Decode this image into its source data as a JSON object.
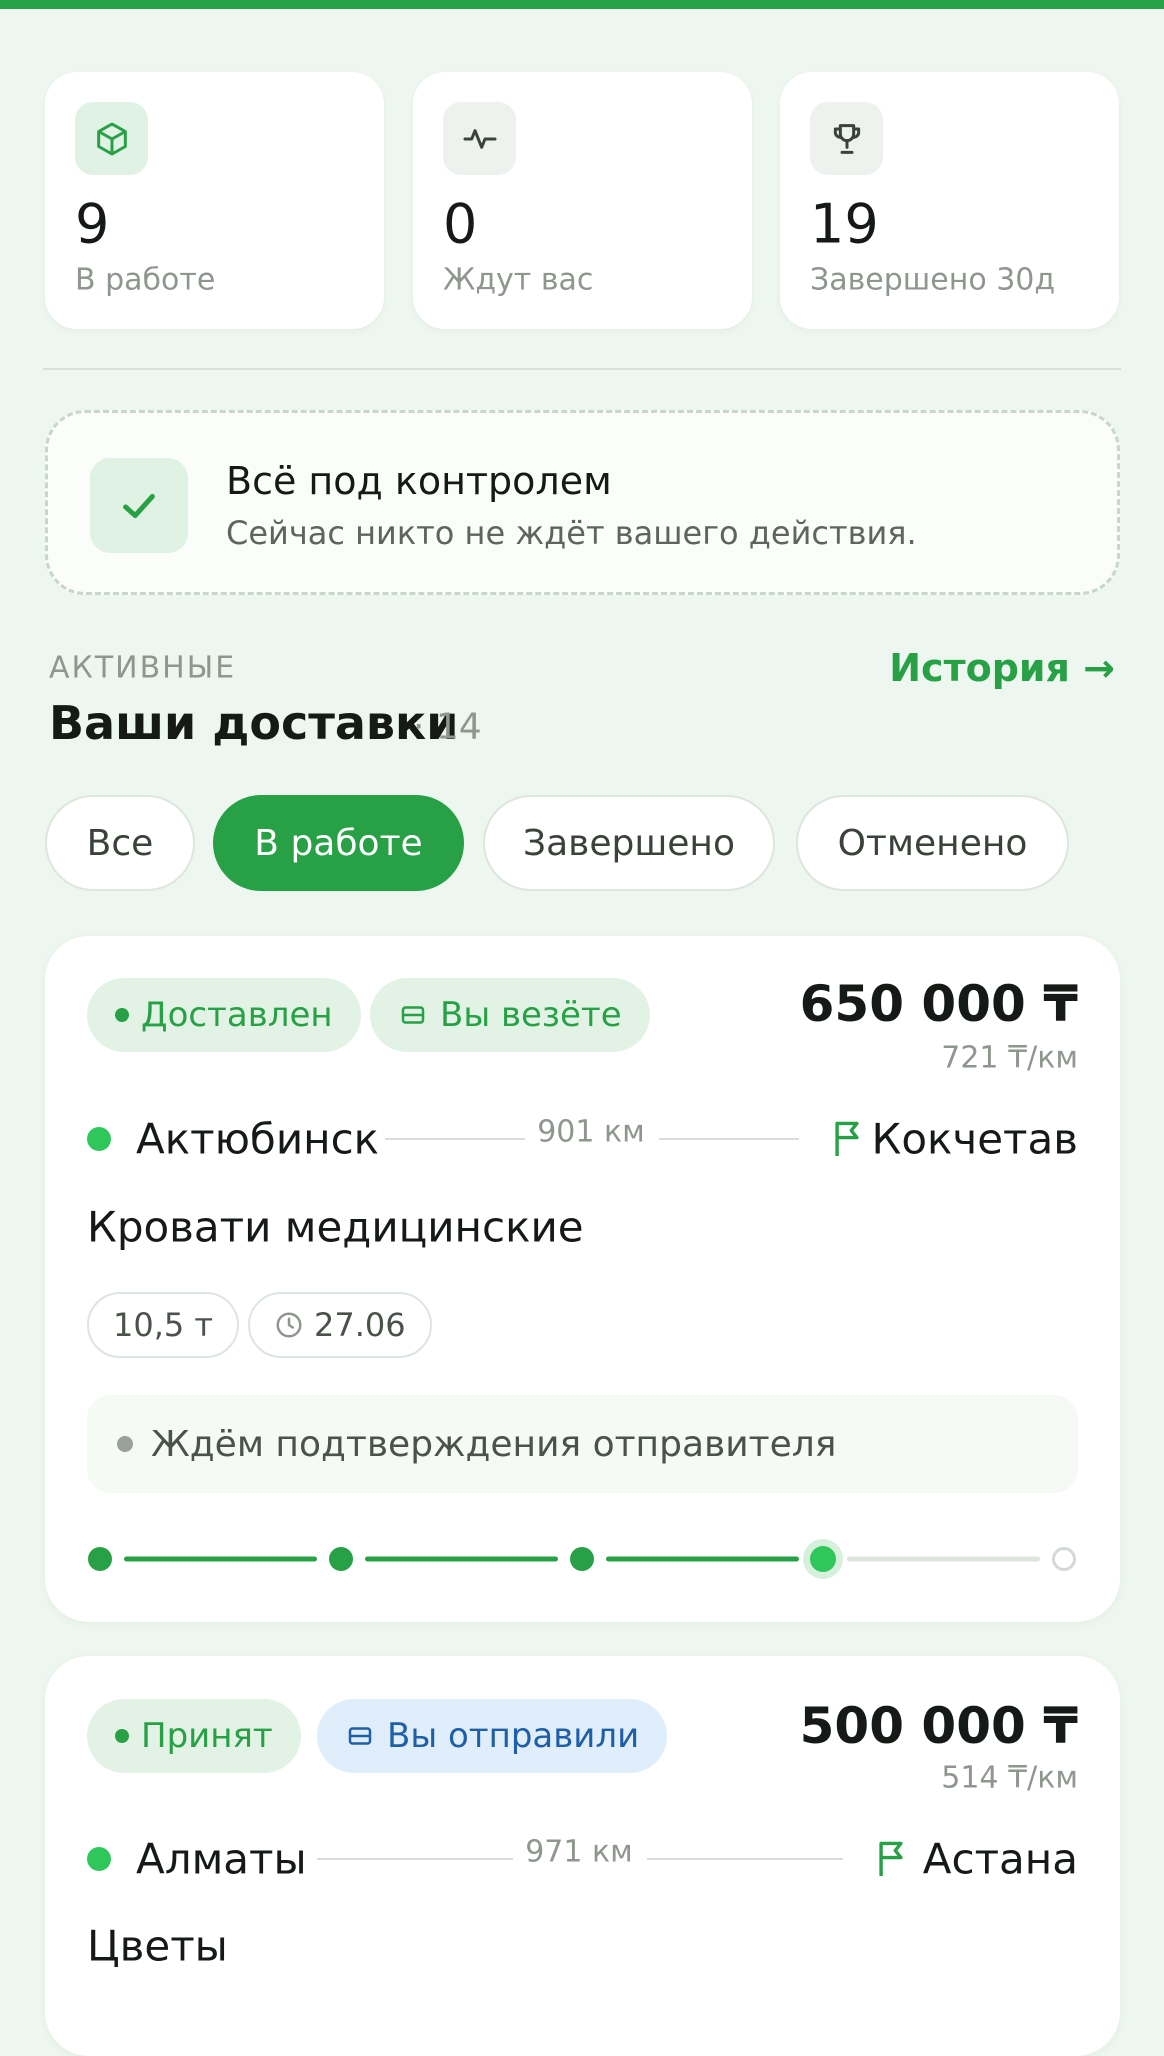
{
  "stats": [
    {
      "value": "9",
      "label": "В работе",
      "icon": "box-icon"
    },
    {
      "value": "0",
      "label": "Ждут вас",
      "icon": "activity-icon"
    },
    {
      "value": "19",
      "label": "Завершено 30д",
      "icon": "trophy-icon"
    }
  ],
  "control": {
    "title": "Всё под контролем",
    "subtitle": "Сейчас никто не ждёт вашего действия."
  },
  "section": {
    "kicker": "АКТИВНЫЕ",
    "title": "Ваши доставки",
    "count": "· 14",
    "history_link": "История →"
  },
  "filters": [
    "Все",
    "В работе",
    "Завершено",
    "Отменено"
  ],
  "active_filter": "В работе",
  "deliveries": [
    {
      "status": "Доставлен",
      "role": "Вы везёте",
      "price": "650 000 ₸",
      "per_km": "721 ₸/км",
      "from": "Актюбинск",
      "distance": "901 км",
      "to": "Кокчетав",
      "cargo": "Кровати медицинские",
      "weight": "10,5 т",
      "date": "27.06",
      "note": "Ждём подтверждения отправителя",
      "progress_steps_done": 4,
      "progress_steps_total": 5
    },
    {
      "status": "Принят",
      "role": "Вы отправили",
      "price": "500 000 ₸",
      "per_km": "514 ₸/км",
      "from": "Алматы",
      "distance": "971 км",
      "to": "Астана",
      "cargo": "Цветы"
    }
  ],
  "colors": {
    "accent": "#27a046",
    "background": "#eef7ef",
    "blue_badge": "#1f5fa8"
  }
}
